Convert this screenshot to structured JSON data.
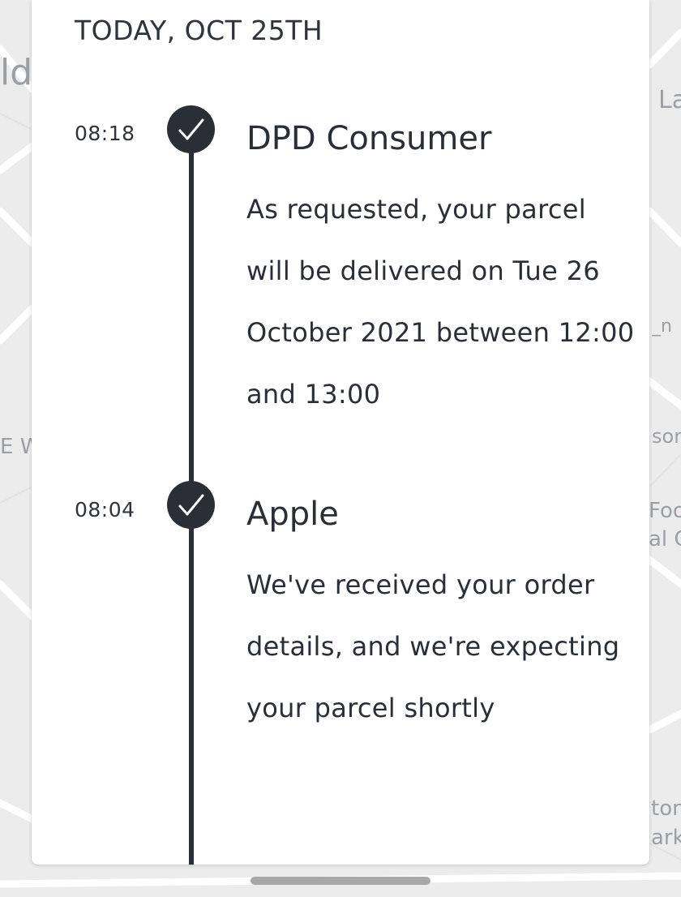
{
  "map": {
    "labels": [
      "ldo",
      "La",
      "_n",
      "son",
      "Food",
      "al G",
      "E W",
      "ton",
      "ark"
    ]
  },
  "timeline": {
    "date_header": "TODAY, OCT 25TH",
    "events": [
      {
        "time": "08:18",
        "sender": "DPD Consumer",
        "message": "As requested, your parcel will be delivered on Tue 26 October 2021 between 12:00 and 13:00",
        "icon": "checkmark-icon"
      },
      {
        "time": "08:04",
        "sender": "Apple",
        "message": "We've received your order details, and we're expecting your parcel shortly",
        "icon": "checkmark-icon"
      }
    ]
  },
  "colors": {
    "timeline": "#2a2e36",
    "card": "#ffffff",
    "map_background": "#ececec"
  }
}
